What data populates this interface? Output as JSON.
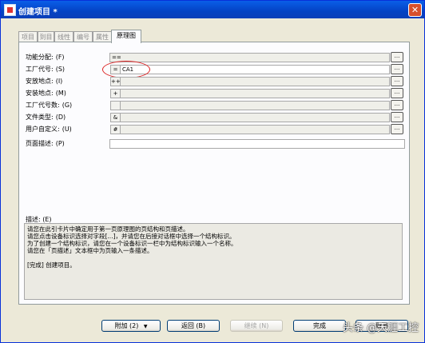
{
  "window": {
    "title": "创建项目 *",
    "close_label": "✕"
  },
  "tabs": [
    {
      "label": "项目"
    },
    {
      "label": "到目"
    },
    {
      "label": "线性"
    },
    {
      "label": "编号"
    },
    {
      "label": "属性"
    },
    {
      "label": "原理图"
    }
  ],
  "fields": [
    {
      "label": "功能分配:",
      "key": "(F)",
      "prefix": "==",
      "value": ""
    },
    {
      "label": "工厂代号:",
      "key": "(S)",
      "prefix": "=",
      "value": "CA1"
    },
    {
      "label": "安放地点:",
      "key": "(I)",
      "prefix": "++",
      "value": ""
    },
    {
      "label": "安装地点:",
      "key": "(M)",
      "prefix": "+",
      "value": ""
    },
    {
      "label": "工厂代号数:",
      "key": "(G)",
      "prefix": "",
      "value": ""
    },
    {
      "label": "文件类型:",
      "key": "(D)",
      "prefix": "&",
      "value": ""
    },
    {
      "label": "用户自定义:",
      "key": "(U)",
      "prefix": "#",
      "value": ""
    },
    {
      "label": "页面描述:",
      "key": "(P)",
      "value": ""
    }
  ],
  "edit_button_label": "...",
  "description": {
    "label": "描述:",
    "key": "(E)",
    "lines": [
      "请您在此引卡片中确定用于第一页原理图的页结构和页描述。",
      "请您点击设备标识选择对字段[...]，并请您在后接对话框中选择一个结构标识。",
      "为了创建一个结构标识，请您在一个设备标识一栏中为结构标识输入一个名称。",
      "请您在「页描述」文本框中为页输入一条描述。",
      "",
      "[完成] 创建项目。"
    ]
  },
  "footer": {
    "append_label": "附加 (2)",
    "append_arrow": "▼",
    "back_label": "返回 (B)",
    "next_label": "继续 (N)",
    "finish_label": "完成",
    "cancel_label": "取消"
  },
  "watermark": "头条 @天涯工控"
}
